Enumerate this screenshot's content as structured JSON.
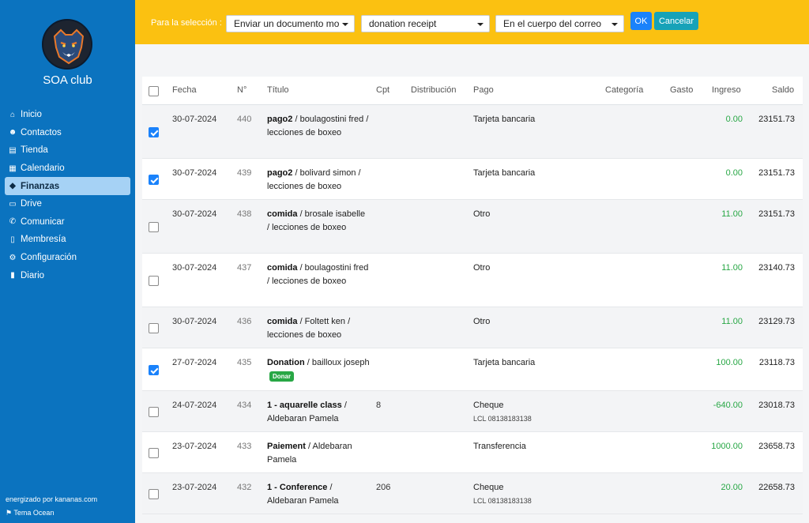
{
  "sidebar": {
    "club_name": "SOA club",
    "items": [
      {
        "label": "Inicio",
        "icon": "home-icon"
      },
      {
        "label": "Contactos",
        "icon": "users-icon"
      },
      {
        "label": "Tienda",
        "icon": "store-icon"
      },
      {
        "label": "Calendario",
        "icon": "calendar-icon"
      },
      {
        "label": "Finanzas",
        "icon": "piggy-bank-icon",
        "active": true
      },
      {
        "label": "Drive",
        "icon": "drive-icon"
      },
      {
        "label": "Comunicar",
        "icon": "broadcast-icon"
      },
      {
        "label": "Membresía",
        "icon": "door-icon"
      },
      {
        "label": "Configuración",
        "icon": "gear-icon"
      },
      {
        "label": "Diario",
        "icon": "book-icon"
      }
    ],
    "footer_powered": "energizado por kananas.com",
    "footer_theme": "Tema Ocean"
  },
  "topbar": {
    "selection_label": "Para la selección :",
    "action_select": "Enviar un documento mo",
    "document_select": "donation receipt",
    "location_select": "En el cuerpo del correo",
    "ok_label": "OK",
    "cancel_label": "Cancelar"
  },
  "table": {
    "headers": {
      "fecha": "Fecha",
      "num": "N°",
      "titulo": "Título",
      "cpt": "Cpt",
      "distribucion": "Distribución",
      "pago": "Pago",
      "categoria": "Categoría",
      "gasto": "Gasto",
      "ingreso": "Ingreso",
      "saldo": "Saldo"
    },
    "rows": [
      {
        "checked": true,
        "date": "30-07-2024",
        "num": "440",
        "title_bold": "pago2",
        "title_rest": " / boulagostini fred / lecciones de boxeo",
        "cpt": "",
        "pago": "Tarjeta bancaria",
        "pago_sub": "",
        "ingreso": "0.00",
        "saldo": "23151.73",
        "badge": ""
      },
      {
        "checked": true,
        "date": "30-07-2024",
        "num": "439",
        "title_bold": "pago2",
        "title_rest": " / bolivard simon / lecciones de boxeo",
        "cpt": "",
        "pago": "Tarjeta bancaria",
        "pago_sub": "",
        "ingreso": "0.00",
        "saldo": "23151.73",
        "badge": ""
      },
      {
        "checked": false,
        "date": "30-07-2024",
        "num": "438",
        "title_bold": "comida",
        "title_rest": " / brosale isabelle / lecciones de boxeo",
        "cpt": "",
        "pago": "Otro",
        "pago_sub": "",
        "ingreso": "11.00",
        "saldo": "23151.73",
        "badge": ""
      },
      {
        "checked": false,
        "date": "30-07-2024",
        "num": "437",
        "title_bold": "comida",
        "title_rest": " / boulagostini fred / lecciones de boxeo",
        "cpt": "",
        "pago": "Otro",
        "pago_sub": "",
        "ingreso": "11.00",
        "saldo": "23140.73",
        "badge": ""
      },
      {
        "checked": false,
        "date": "30-07-2024",
        "num": "436",
        "title_bold": "comida",
        "title_rest": " / Foltett ken / lecciones de boxeo",
        "cpt": "",
        "pago": "Otro",
        "pago_sub": "",
        "ingreso": "11.00",
        "saldo": "23129.73",
        "badge": ""
      },
      {
        "checked": true,
        "date": "27-07-2024",
        "num": "435",
        "title_bold": "Donation",
        "title_rest": " / bailloux joseph",
        "cpt": "",
        "pago": "Tarjeta bancaria",
        "pago_sub": "",
        "ingreso": "100.00",
        "saldo": "23118.73",
        "badge": "Donar"
      },
      {
        "checked": false,
        "date": "24-07-2024",
        "num": "434",
        "title_bold": "1 - aquarelle class",
        "title_rest": " / Aldebaran Pamela",
        "cpt": "8",
        "pago": "Cheque",
        "pago_sub": "LCL 08138183138",
        "ingreso": "-640.00",
        "saldo": "23018.73",
        "badge": ""
      },
      {
        "checked": false,
        "date": "23-07-2024",
        "num": "433",
        "title_bold": "Paiement",
        "title_rest": " / Aldebaran Pamela",
        "cpt": "",
        "pago": "Transferencia",
        "pago_sub": "",
        "ingreso": "1000.00",
        "saldo": "23658.73",
        "badge": ""
      },
      {
        "checked": false,
        "date": "23-07-2024",
        "num": "432",
        "title_bold": "1 - Conference",
        "title_rest": " / Aldebaran Pamela",
        "cpt": "206",
        "pago": "Cheque",
        "pago_sub": "LCL 08138183138",
        "ingreso": "20.00",
        "saldo": "22658.73",
        "badge": ""
      }
    ]
  },
  "colors": {
    "sidebar": "#0b73bf",
    "topbar": "#fbc111",
    "positive": "#28a745",
    "primary": "#1a82fb"
  }
}
